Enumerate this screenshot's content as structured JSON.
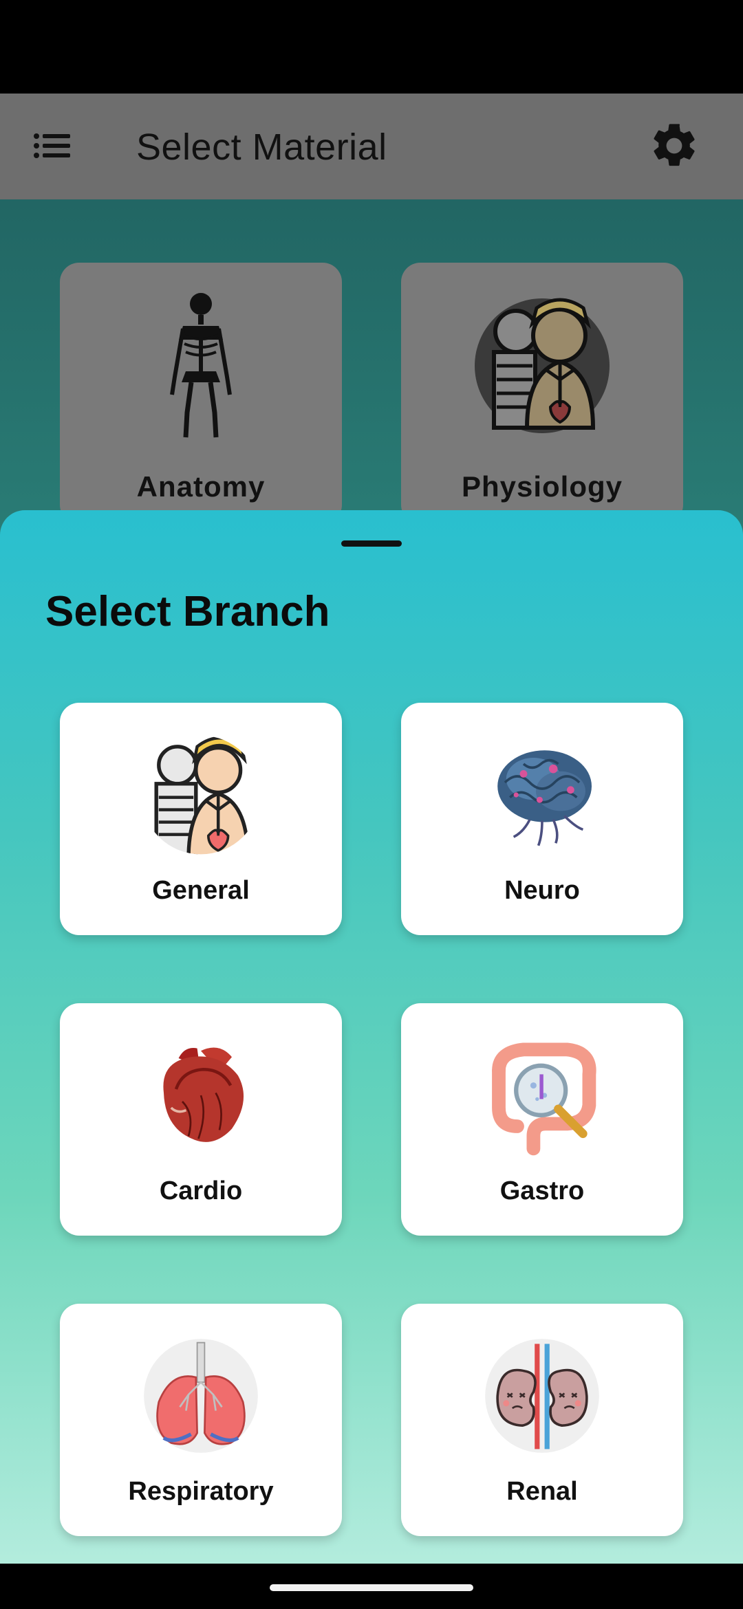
{
  "app_bar": {
    "title": "Select Material",
    "menu_icon": "list-icon",
    "settings_icon": "gear-icon"
  },
  "materials": [
    {
      "label": "Anatomy",
      "icon": "skeleton-icon"
    },
    {
      "label": "Physiology",
      "icon": "human-body-icon"
    }
  ],
  "sheet": {
    "title": "Select Branch",
    "branches": [
      {
        "label": "General",
        "icon": "human-body-icon"
      },
      {
        "label": "Neuro",
        "icon": "brain-icon"
      },
      {
        "label": "Cardio",
        "icon": "heart-icon"
      },
      {
        "label": "Gastro",
        "icon": "intestine-magnifier-icon"
      },
      {
        "label": "Respiratory",
        "icon": "lungs-icon"
      },
      {
        "label": "Renal",
        "icon": "kidneys-icon"
      }
    ]
  },
  "colors": {
    "app_bar": "#6e6e6e",
    "sheet_top": "#29bfcf",
    "sheet_bottom": "#b3ecdd",
    "card": "#ffffff"
  }
}
